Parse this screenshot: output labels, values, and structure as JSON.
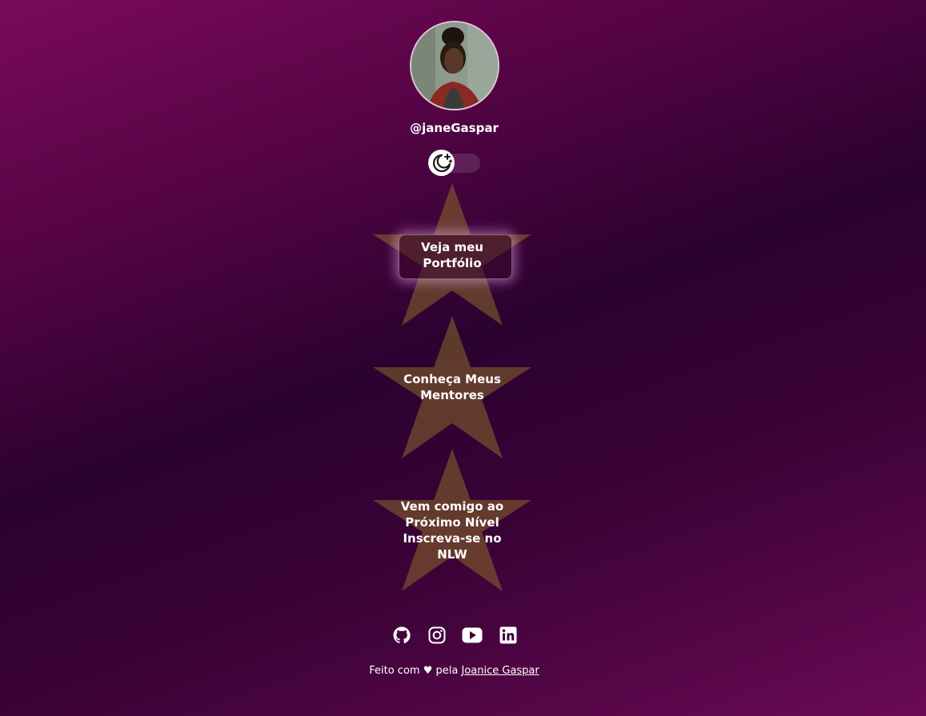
{
  "profile": {
    "handle": "@janeGaspar"
  },
  "theme_switch": {
    "icon": "moon-stars-icon"
  },
  "links": [
    {
      "label_line1": "Veja meu",
      "label_line2": "Portfólio",
      "label_line3": "",
      "label_line4": ""
    },
    {
      "label_line1": "Conheça Meus",
      "label_line2": "Mentores",
      "label_line3": "",
      "label_line4": ""
    },
    {
      "label_line1": "Vem comigo ao",
      "label_line2": "Próximo Nível",
      "label_line3": "Inscreva-se no",
      "label_line4": "NLW"
    }
  ],
  "social": {
    "icons": [
      "github-icon",
      "instagram-icon",
      "youtube-icon",
      "linkedin-icon"
    ]
  },
  "footer": {
    "prefix": "Feito com",
    "heart": "♥",
    "by": "pela",
    "author": "Joanice Gaspar"
  },
  "colors": {
    "star_fill": "#8a6a2a",
    "accent_glow": "#ffbeff",
    "background_dark": "#2b0230",
    "background_light": "#7a0a5c"
  }
}
